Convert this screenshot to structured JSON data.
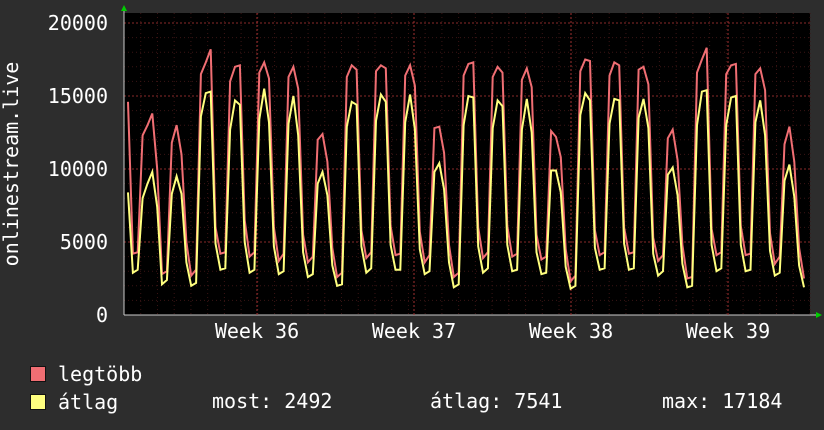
{
  "chart_data": {
    "type": "line",
    "title": "",
    "xlabel": "",
    "ylabel": "onlinestream.live",
    "ylim": [
      0,
      20000
    ],
    "y_ticks": [
      0,
      5000,
      10000,
      15000,
      20000
    ],
    "x_ticks": [
      "Week 36",
      "Week 37",
      "Week 38",
      "Week 39"
    ],
    "grid": true,
    "series": [
      {
        "name": "legtöbb",
        "color": "#f06e73",
        "values": [
          14600,
          4200,
          4300,
          12300,
          13000,
          13800,
          10000,
          2800,
          3000,
          11800,
          13000,
          11000,
          5000,
          2700,
          3100,
          16500,
          17300,
          18200,
          6000,
          4200,
          4300,
          16000,
          17000,
          17100,
          6500,
          4000,
          4300,
          16600,
          17300,
          16200,
          6000,
          3700,
          4200,
          16300,
          17000,
          15500,
          5500,
          3600,
          4000,
          12000,
          12400,
          10500,
          4600,
          2600,
          2900,
          16300,
          17100,
          16800,
          5800,
          3900,
          4300,
          16700,
          17100,
          16900,
          6100,
          4100,
          4200,
          16400,
          17100,
          15700,
          5700,
          3600,
          4100,
          12800,
          12900,
          11100,
          4800,
          2600,
          2900,
          16400,
          17200,
          17300,
          6000,
          3900,
          4300,
          16300,
          17000,
          16600,
          6100,
          4000,
          4200,
          16100,
          16900,
          15600,
          5500,
          3800,
          4000,
          12600,
          12200,
          10800,
          4500,
          2300,
          2700,
          16700,
          17500,
          17400,
          5800,
          4100,
          4300,
          16400,
          17300,
          17100,
          6000,
          4200,
          4300,
          16800,
          17000,
          15800,
          5300,
          3700,
          4100,
          12100,
          12700,
          10600,
          4800,
          2500,
          2600,
          16600,
          17500,
          18300,
          5900,
          4100,
          4300,
          16500,
          17100,
          17200,
          6100,
          4100,
          4200,
          16500,
          16900,
          15400,
          5600,
          3500,
          4000,
          11700,
          12900,
          10500,
          4600,
          2500
        ]
      },
      {
        "name": "átlag",
        "color": "#ffff7f",
        "values": [
          8400,
          2900,
          3100,
          8000,
          9000,
          9800,
          7400,
          2100,
          2400,
          8300,
          9500,
          8300,
          3600,
          2000,
          2200,
          13600,
          15200,
          15300,
          4900,
          3100,
          3200,
          12700,
          14700,
          14400,
          5000,
          2900,
          3100,
          13400,
          15500,
          13200,
          4700,
          2800,
          3000,
          13100,
          15000,
          12300,
          4300,
          2600,
          2800,
          9000,
          9800,
          8200,
          3400,
          2000,
          2100,
          12900,
          14600,
          14400,
          4700,
          2900,
          3200,
          13300,
          15100,
          14600,
          4800,
          3100,
          3100,
          13200,
          15100,
          12700,
          4500,
          2800,
          3000,
          9800,
          10400,
          8600,
          3600,
          1900,
          2100,
          13000,
          15000,
          14900,
          4700,
          2900,
          3200,
          12800,
          14700,
          14300,
          4800,
          3000,
          3100,
          12700,
          14800,
          12500,
          4300,
          2800,
          2900,
          9900,
          9900,
          8400,
          3300,
          1800,
          2000,
          13700,
          15200,
          14700,
          4600,
          3100,
          3200,
          13100,
          14800,
          14700,
          4900,
          3100,
          3200,
          13500,
          14800,
          12800,
          4200,
          2700,
          3000,
          9600,
          10100,
          8200,
          3500,
          1900,
          2000,
          13000,
          15300,
          15400,
          4800,
          3000,
          3200,
          13000,
          14900,
          15000,
          4800,
          3000,
          3100,
          13200,
          14700,
          12300,
          4400,
          2700,
          2900,
          9200,
          10300,
          8100,
          3400,
          1900
        ]
      }
    ]
  },
  "legend": {
    "items": [
      {
        "label": "legtöbb",
        "color": "#f06e73"
      },
      {
        "label": "átlag",
        "color": "#ffff7f"
      }
    ]
  },
  "stats": {
    "most": "most: 2492",
    "atlag": "átlag: 7541",
    "max": "max: 17184"
  },
  "colors": {
    "background": "#2d2d2d",
    "plot_background": "#000000",
    "grid": "#6b2020",
    "axis_arrow": "#00cc00"
  }
}
